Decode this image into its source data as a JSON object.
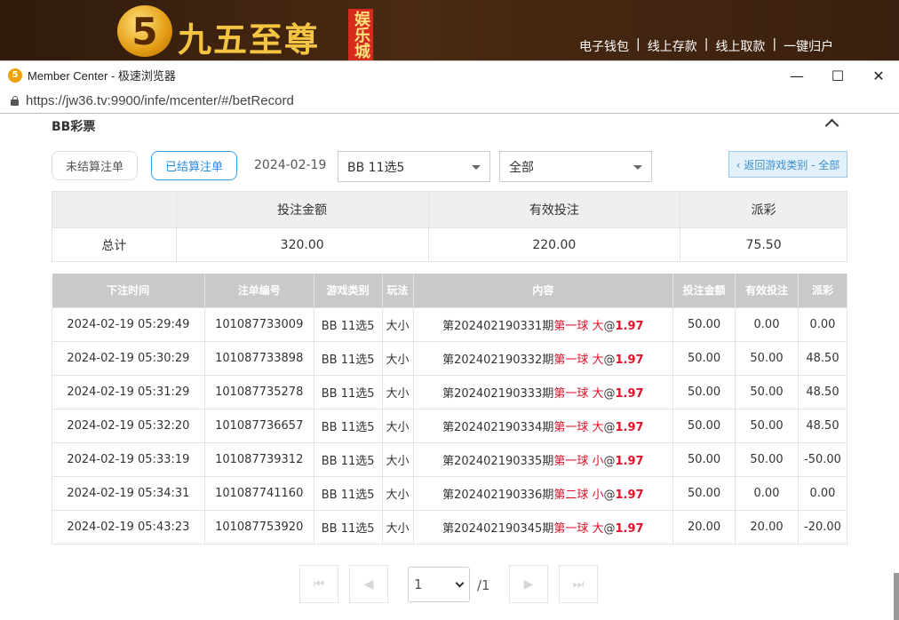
{
  "site": {
    "name": "九五至尊",
    "badge": "娱乐城",
    "logo_glyph": "5",
    "nav": [
      "电子钱包",
      "线上存款",
      "线上取款",
      "一键归户"
    ],
    "brand_color": "#f5c542"
  },
  "browser": {
    "title": "Member Center - 极速浏览器",
    "url": "https://jw36.tv:9900/infe/mcenter/#/betRecord",
    "controls": [
      "minimize-icon",
      "maximize-icon",
      "close-icon"
    ]
  },
  "section": {
    "title": "BB彩票"
  },
  "filters": {
    "unsettled_label": "未结算注单",
    "settled_label": "已结算注单",
    "date": "2024-02-19",
    "game_select": "BB 11选5",
    "scope_select": "全部",
    "back_label": "‹ 返回游戏类别 - 全部",
    "accent_color": "#2a8de0"
  },
  "summary": {
    "headers": [
      "投注金额",
      "有效投注",
      "派彩"
    ],
    "row_label": "总计",
    "values": [
      "320.00",
      "220.00",
      "75.50"
    ]
  },
  "records": {
    "headers": [
      "下注时间",
      "注单编号",
      "游戏类别",
      "玩法",
      "内容",
      "投注金额",
      "有效投注",
      "派彩"
    ],
    "rows": [
      {
        "time": "2024-02-19 05:29:49",
        "id": "101087733009",
        "game": "BB 11选5",
        "play": "大小",
        "period": "第202402190331期",
        "pick": "第一球 大",
        "at": "@",
        "odds": "1.97",
        "bet": "50.00",
        "valid": "0.00",
        "payout": "0.00"
      },
      {
        "time": "2024-02-19 05:30:29",
        "id": "101087733898",
        "game": "BB 11选5",
        "play": "大小",
        "period": "第202402190332期",
        "pick": "第一球 大",
        "at": "@",
        "odds": "1.97",
        "bet": "50.00",
        "valid": "50.00",
        "payout": "48.50"
      },
      {
        "time": "2024-02-19 05:31:29",
        "id": "101087735278",
        "game": "BB 11选5",
        "play": "大小",
        "period": "第202402190333期",
        "pick": "第一球 大",
        "at": "@",
        "odds": "1.97",
        "bet": "50.00",
        "valid": "50.00",
        "payout": "48.50"
      },
      {
        "time": "2024-02-19 05:32:20",
        "id": "101087736657",
        "game": "BB 11选5",
        "play": "大小",
        "period": "第202402190334期",
        "pick": "第一球 大",
        "at": "@",
        "odds": "1.97",
        "bet": "50.00",
        "valid": "50.00",
        "payout": "48.50"
      },
      {
        "time": "2024-02-19 05:33:19",
        "id": "101087739312",
        "game": "BB 11选5",
        "play": "大小",
        "period": "第202402190335期",
        "pick": "第一球 小",
        "at": "@",
        "odds": "1.97",
        "bet": "50.00",
        "valid": "50.00",
        "payout": "-50.00"
      },
      {
        "time": "2024-02-19 05:34:31",
        "id": "101087741160",
        "game": "BB 11选5",
        "play": "大小",
        "period": "第202402190336期",
        "pick": "第二球 小",
        "at": "@",
        "odds": "1.97",
        "bet": "50.00",
        "valid": "0.00",
        "payout": "0.00"
      },
      {
        "time": "2024-02-19 05:43:23",
        "id": "101087753920",
        "game": "BB 11选5",
        "play": "大小",
        "period": "第202402190345期",
        "pick": "第一球 大",
        "at": "@",
        "odds": "1.97",
        "bet": "20.00",
        "valid": "20.00",
        "payout": "-20.00"
      }
    ],
    "negative_color": "#e0122a"
  },
  "pager": {
    "current": "1",
    "total": "/1"
  }
}
